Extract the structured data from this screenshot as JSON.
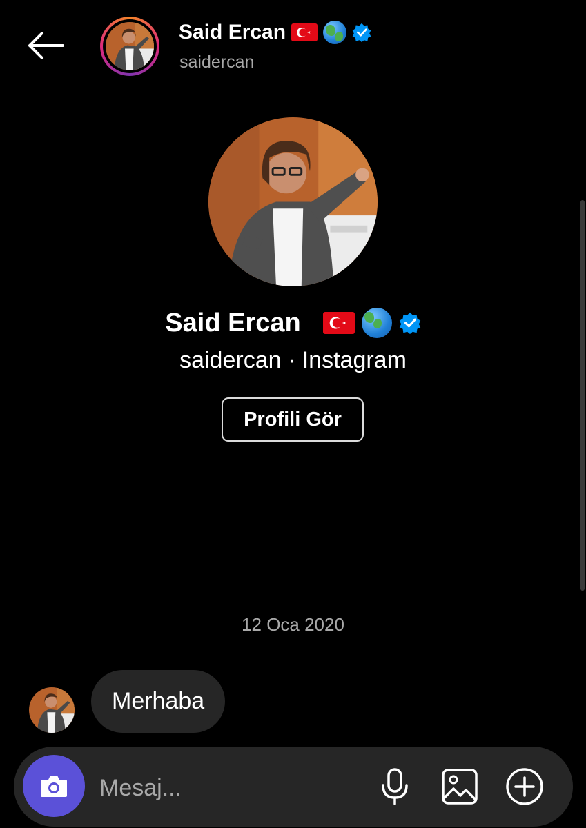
{
  "header": {
    "name": "Said Ercan",
    "username": "saidercan",
    "badges": [
      "turkey-flag-emoji",
      "globe-emoji",
      "verified-badge"
    ]
  },
  "profile": {
    "name": "Said Ercan",
    "subtitle": "saidercan · Instagram",
    "view_profile_label": "Profili Gör"
  },
  "conversation": {
    "date": "12 Oca 2020",
    "messages": [
      {
        "text": "Merhaba",
        "from": "other"
      }
    ]
  },
  "composer": {
    "placeholder": "Mesaj...",
    "icons": [
      "camera-icon",
      "microphone-icon",
      "image-icon",
      "plus-circle-icon"
    ]
  },
  "colors": {
    "background": "#000000",
    "bubble": "#262626",
    "camera_button": "#5b51d8",
    "verified": "#0095f6",
    "secondary_text": "#a8a8a8"
  }
}
